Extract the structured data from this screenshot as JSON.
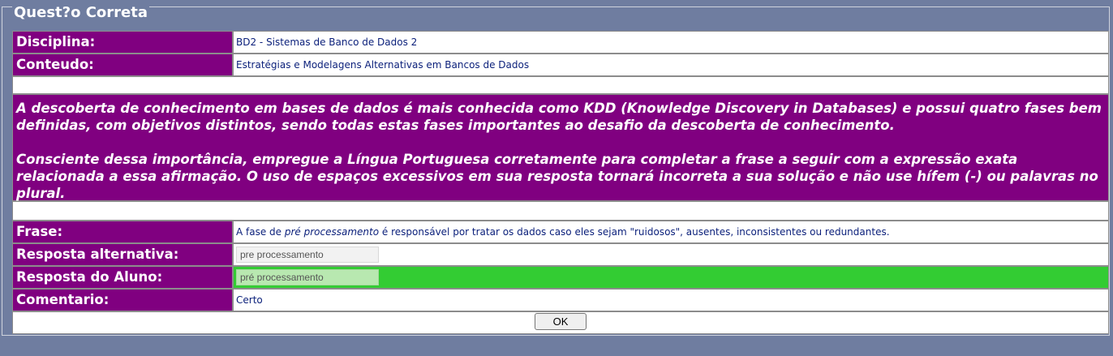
{
  "panel": {
    "title": "Quest?o Correta"
  },
  "info": {
    "disciplina_label": "Disciplina:",
    "disciplina_value": "BD2 - Sistemas de Banco de Dados 2",
    "conteudo_label": "Conteudo:",
    "conteudo_value": "Estratégias e Modelagens Alternativas em Bancos de Dados"
  },
  "question": {
    "paragraph1": "A descoberta de conhecimento em bases de dados é mais conhecida como KDD (Knowledge Discovery in Databases) e possui quatro fases bem definidas, com objetivos distintos, sendo todas estas fases importantes ao desafio da descoberta de conhecimento.",
    "paragraph2": "Consciente dessa importância, empregue a Língua Portuguesa corretamente para completar a frase a seguir com a expressão exata relacionada a essa afirmação. O uso de espaços excessivos em sua resposta tornará incorreta a sua solução e não use hífem (-) ou palavras no plural."
  },
  "frase": {
    "label": "Frase:",
    "before": "A fase de ",
    "emphasis": "pré processamento",
    "after": " é responsável por tratar os dados caso eles sejam \"ruidosos\", ausentes, inconsistentes ou redundantes."
  },
  "resposta_alternativa": {
    "label": "Resposta alternativa:",
    "value": "pre processamento"
  },
  "resposta_aluno": {
    "label": "Resposta do Aluno:",
    "value": "pré processamento"
  },
  "comentario": {
    "label": "Comentario:",
    "value": "Certo"
  },
  "actions": {
    "ok_label": "OK"
  },
  "colors": {
    "page_bg": "#6f7da0",
    "label_bg": "#800080",
    "correct_bg": "#33cc33",
    "value_text": "#0a1f7a"
  }
}
